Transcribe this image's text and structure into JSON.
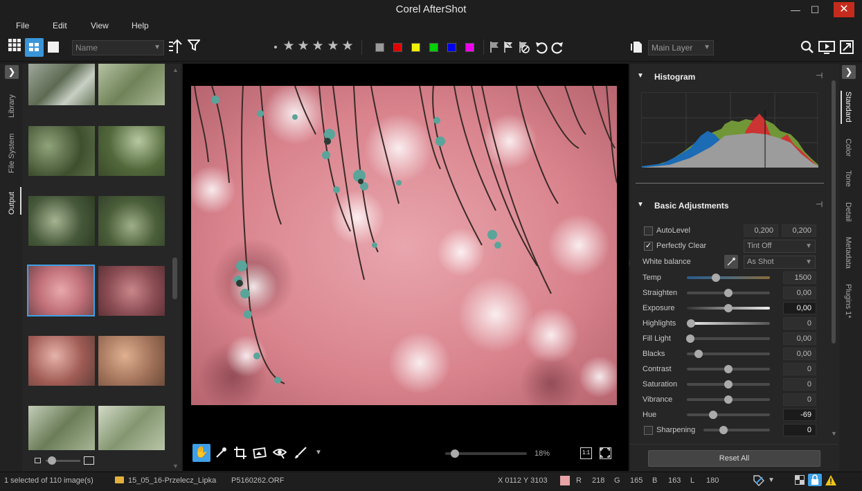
{
  "app": {
    "title": "Corel AfterShot"
  },
  "window_buttons": {
    "minimize": "—",
    "maximize": "☐",
    "close": "✕"
  },
  "menu": [
    "File",
    "Edit",
    "View",
    "Help"
  ],
  "toolbar": {
    "sort_select": "Name",
    "layer_select": "Main Layer",
    "color_labels": [
      "#9a9a9a",
      "#e00000",
      "#f0f000",
      "#00d000",
      "#0000ee",
      "#ee00ee"
    ]
  },
  "left_tabs": [
    "Library",
    "File System",
    "Output"
  ],
  "right_tabs": [
    "Standard",
    "Color",
    "Tone",
    "Detail",
    "Metadata",
    "Plugins 1*"
  ],
  "histogram": {
    "title": "Histogram"
  },
  "basic": {
    "title": "Basic Adjustments",
    "autolevel": {
      "label": "AutoLevel",
      "v1": "0,200",
      "v2": "0,200",
      "checked": false
    },
    "perfectly_clear": {
      "label": "Perfectly Clear",
      "option": "Tint Off",
      "checked": true
    },
    "white_balance": {
      "label": "White balance",
      "option": "As Shot"
    },
    "sliders": [
      {
        "label": "Temp",
        "value": "1500",
        "pos": 0.35,
        "highlight": false
      },
      {
        "label": "Straighten",
        "value": "0,00",
        "pos": 0.5,
        "highlight": false
      },
      {
        "label": "Exposure",
        "value": "0,00",
        "pos": 0.5,
        "highlight": true
      },
      {
        "label": "Highlights",
        "value": "0",
        "pos": 0.05,
        "highlight": false
      },
      {
        "label": "Fill Light",
        "value": "0,00",
        "pos": 0.04,
        "highlight": false
      },
      {
        "label": "Blacks",
        "value": "0,00",
        "pos": 0.14,
        "highlight": false
      },
      {
        "label": "Contrast",
        "value": "0",
        "pos": 0.5,
        "highlight": false
      },
      {
        "label": "Saturation",
        "value": "0",
        "pos": 0.5,
        "highlight": false
      },
      {
        "label": "Vibrance",
        "value": "0",
        "pos": 0.5,
        "highlight": false
      },
      {
        "label": "Hue",
        "value": "-69",
        "pos": 0.32,
        "highlight": true
      }
    ],
    "sharpening": {
      "label": "Sharpening",
      "value": "0",
      "pos": 0.3
    }
  },
  "reset_all": "Reset All",
  "viewer": {
    "zoom": "18%"
  },
  "status": {
    "selection": "1 selected of 110 image(s)",
    "folder": "15_05_16-Przelecz_Lipka",
    "file": "P5160262.ORF",
    "coords": "X 0112  Y 3103",
    "r_label": "R",
    "r_value": "218",
    "g_label": "G",
    "g_value": "165",
    "b_label": "B",
    "b_value": "163",
    "l_label": "L",
    "l_value": "180"
  }
}
